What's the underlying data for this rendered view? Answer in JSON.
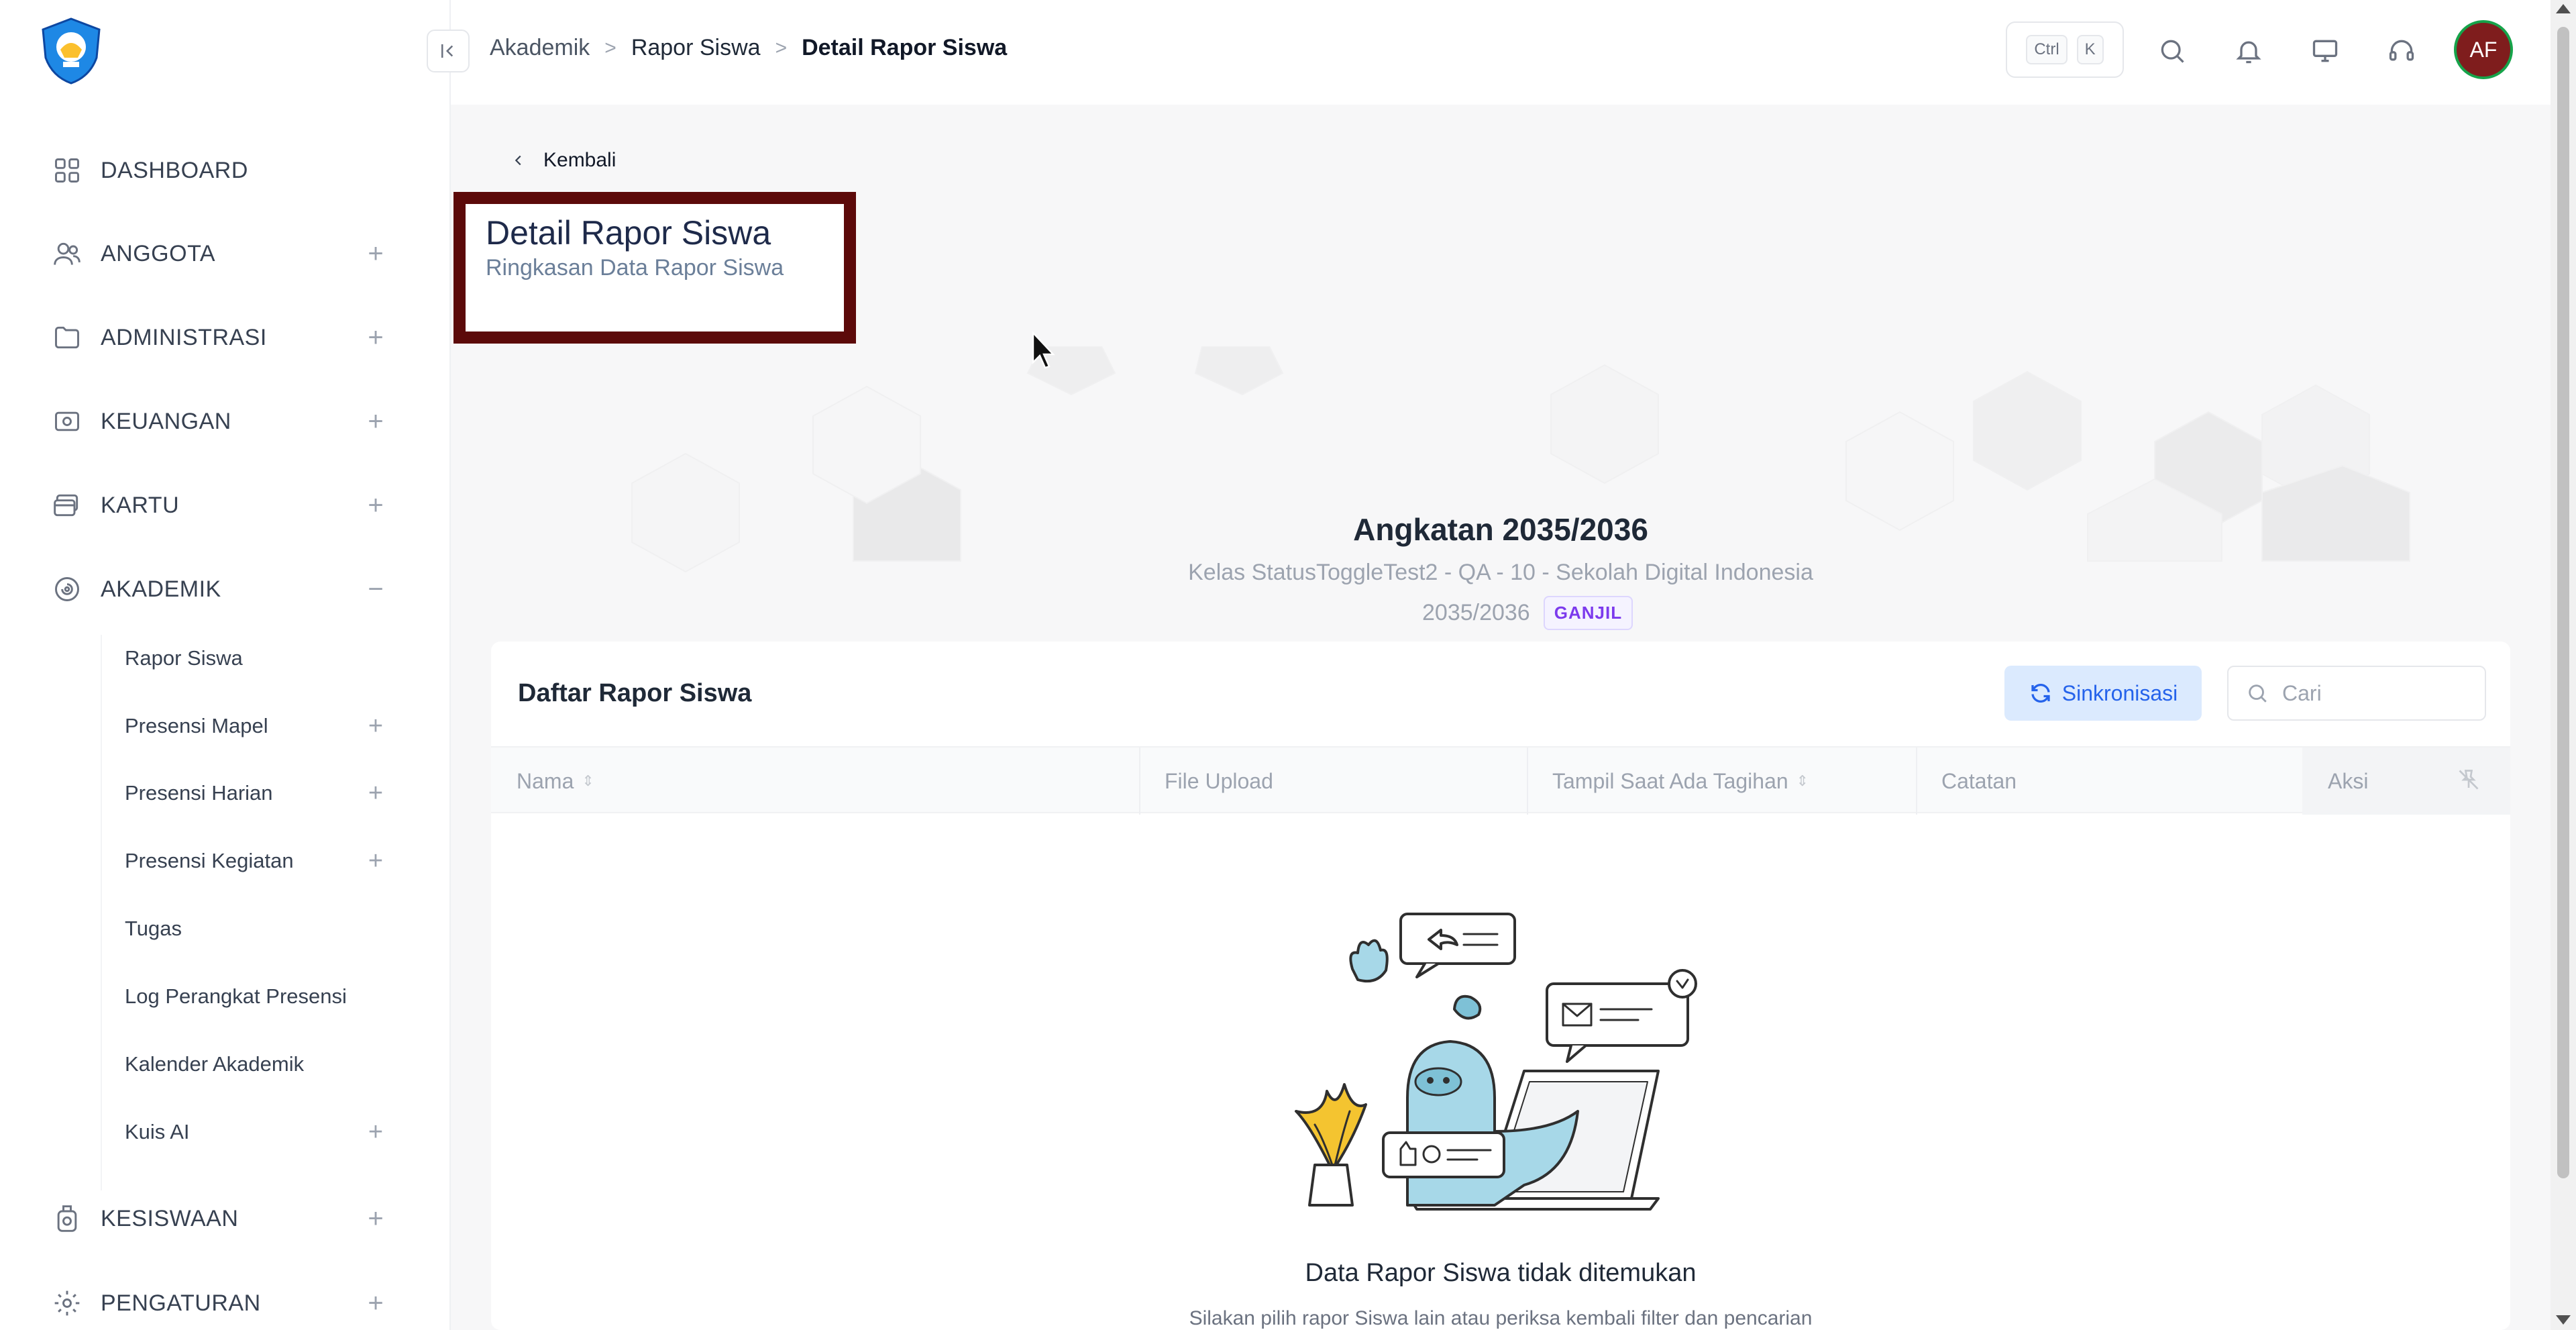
{
  "sidebar": {
    "items": [
      {
        "label": "DASHBOARD",
        "icon": "grid-icon",
        "toggle": ""
      },
      {
        "label": "ANGGOTA",
        "icon": "users-icon",
        "toggle": "+"
      },
      {
        "label": "ADMINISTRASI",
        "icon": "folder-icon",
        "toggle": "+"
      },
      {
        "label": "KEUANGAN",
        "icon": "money-icon",
        "toggle": "+"
      },
      {
        "label": "KARTU",
        "icon": "card-icon",
        "toggle": "+"
      },
      {
        "label": "AKADEMIK",
        "icon": "academic-icon",
        "toggle": "−"
      }
    ],
    "subitems": [
      {
        "label": "Rapor Siswa",
        "toggle": ""
      },
      {
        "label": "Presensi Mapel",
        "toggle": "+"
      },
      {
        "label": "Presensi Harian",
        "toggle": "+"
      },
      {
        "label": "Presensi Kegiatan",
        "toggle": "+"
      },
      {
        "label": "Tugas",
        "toggle": ""
      },
      {
        "label": "Log Perangkat Presensi",
        "toggle": ""
      },
      {
        "label": "Kalender Akademik",
        "toggle": ""
      },
      {
        "label": "Kuis AI",
        "toggle": "+"
      }
    ],
    "bottom_items": [
      {
        "label": "KESISWAAN",
        "icon": "student-icon",
        "toggle": "+"
      },
      {
        "label": "PENGATURAN",
        "icon": "settings-icon",
        "toggle": "+"
      }
    ]
  },
  "header": {
    "breadcrumb": [
      "Akademik",
      "Rapor Siswa",
      "Detail Rapor Siswa"
    ],
    "shortcut_keys": [
      "Ctrl",
      "K"
    ],
    "avatar_initials": "AF"
  },
  "page": {
    "back_label": "Kembali",
    "title": "Detail Rapor Siswa",
    "subtitle": "Ringkasan Data Rapor Siswa"
  },
  "hero": {
    "title": "Angkatan 2035/2036",
    "class_line": "Kelas StatusToggleTest2 - QA - 10 - Sekolah Digital Indonesia",
    "year": "2035/2036",
    "semester_badge": "GANJIL"
  },
  "table": {
    "title": "Daftar Rapor Siswa",
    "sync_label": "Sinkronisasi",
    "search_placeholder": "Cari",
    "columns": [
      "Nama",
      "File Upload",
      "Tampil Saat Ada Tagihan",
      "Catatan",
      "Aksi"
    ],
    "empty_title": "Data Rapor Siswa tidak ditemukan",
    "empty_subtitle": "Silakan pilih rapor Siswa lain atau periksa kembali filter dan pencarian"
  },
  "colors": {
    "accent": "#2563eb",
    "title_box_border": "#5c0a0a",
    "badge_purple": "#7c3aed",
    "avatar_bg": "#7f1d1d"
  }
}
